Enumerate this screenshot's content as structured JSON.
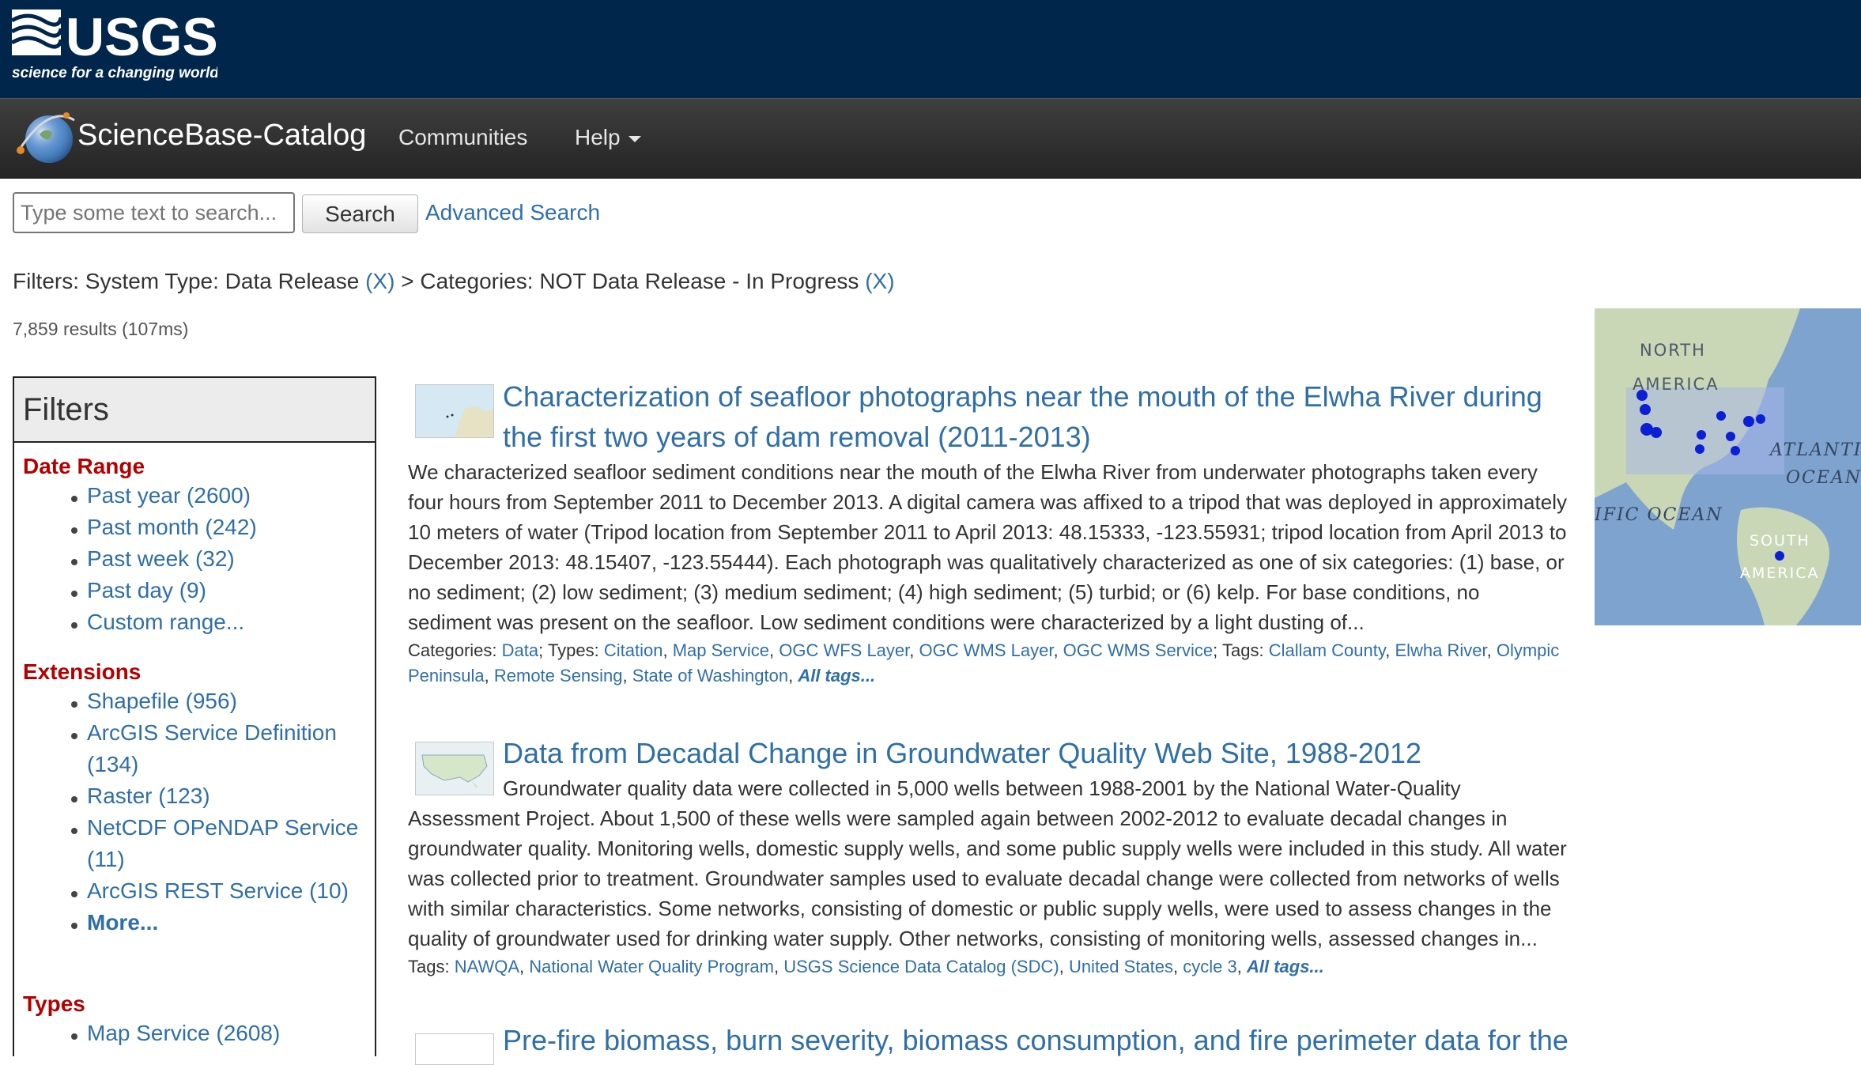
{
  "usgs": {
    "wordmark": "USGS",
    "tagline": "science for a changing world"
  },
  "nav": {
    "brand": "ScienceBase-Catalog",
    "communities": "Communities",
    "help": "Help"
  },
  "search": {
    "placeholder": "Type some text to search...",
    "button": "Search",
    "advanced": "Advanced Search"
  },
  "filters_line": {
    "prefix": "Filters: System Type: Data Release ",
    "remove1": "(X)",
    "middle": " > Categories: NOT Data Release - In Progress ",
    "remove2": "(X)"
  },
  "results_count": "7,859 results (107ms)",
  "filters": {
    "heading": "Filters",
    "date_range": {
      "title": "Date Range",
      "items": [
        "Past year (2600)",
        "Past month (242)",
        "Past week (32)",
        "Past day (9)",
        "Custom range..."
      ]
    },
    "extensions": {
      "title": "Extensions",
      "items": [
        "Shapefile (956)",
        "ArcGIS Service Definition",
        "(134)",
        "Raster (123)",
        "NetCDF OPeNDAP Service",
        "(11)",
        "ArcGIS REST Service (10)"
      ],
      "more": "More..."
    },
    "types": {
      "title": "Types",
      "items": [
        "Map Service (2608)"
      ]
    }
  },
  "results": [
    {
      "title_line1": "Characterization of seafloor photographs near the mouth of the Elwha River during",
      "title_line2": "the first two years of dam removal (2011-2013)",
      "desc": [
        "We characterized seafloor sediment conditions near the mouth of the Elwha River from underwater photographs taken every",
        "four hours from September 2011 to December 2013. A digital camera was affixed to a tripod that was deployed in approximately",
        "10 meters of water (Tripod location from September 2011 to April 2013: 48.15333, -123.55931; tripod location from April 2013 to",
        "December 2013: 48.15407, -123.55444). Each photograph was qualitatively characterized as one of six categories: (1) base, or",
        "no sediment; (2) low sediment; (3) medium sediment; (4) high sediment; (5) turbid; or (6) kelp. For base conditions, no",
        "sediment was present on the seafloor. Low sediment conditions were characterized by a light dusting of..."
      ],
      "meta": {
        "categories_label": "Categories:",
        "categories": [
          "Data"
        ],
        "types_label": "Types:",
        "types": [
          "Citation",
          "Map Service",
          "OGC WFS Layer",
          "OGC WMS Layer",
          "OGC WMS Service"
        ],
        "tags_label": "Tags:",
        "tags": [
          "Clallam County",
          "Elwha River",
          "Olympic Peninsula",
          "Remote Sensing",
          "State of Washington"
        ],
        "all_tags": "All tags..."
      }
    },
    {
      "title_line1": "Data from Decadal Change in Groundwater Quality Web Site, 1988-2012",
      "desc": [
        "Groundwater quality data were collected in 5,000 wells between 1988-2001 by the National Water-Quality",
        "Assessment Project. About 1,500 of these wells were sampled again between 2002-2012 to evaluate decadal changes in",
        "groundwater quality. Monitoring wells, domestic supply wells, and some public supply wells were included in this study. All water",
        "was collected prior to treatment. Groundwater samples used to evaluate decadal change were collected from networks of wells",
        "with similar characteristics. Some networks, consisting of domestic or public supply wells, were used to assess changes in the",
        "quality of groundwater used for drinking water supply. Other networks, consisting of monitoring wells, assessed changes in..."
      ],
      "meta": {
        "tags_label": "Tags:",
        "tags": [
          "NAWQA",
          "National Water Quality Program",
          "USGS Science Data Catalog (SDC)",
          "United States",
          "cycle 3"
        ],
        "all_tags": "All tags..."
      }
    },
    {
      "title_line1": "Pre-fire biomass, burn severity, biomass consumption, and fire perimeter data for the"
    }
  ],
  "map": {
    "labels": [
      "NORTH",
      "AMERICA",
      "ATLANTIC",
      "OCEAN",
      "IFIC OCEAN",
      "SOUTH",
      "AMERICA"
    ],
    "ocean_color": "#7fa3cf",
    "land_color": "#c9d7b6",
    "point_color": "#0a1fd6"
  },
  "colors": {
    "usgs_blue": "#00264c",
    "link": "#2f6fa8",
    "facet_heading": "#b30000"
  }
}
